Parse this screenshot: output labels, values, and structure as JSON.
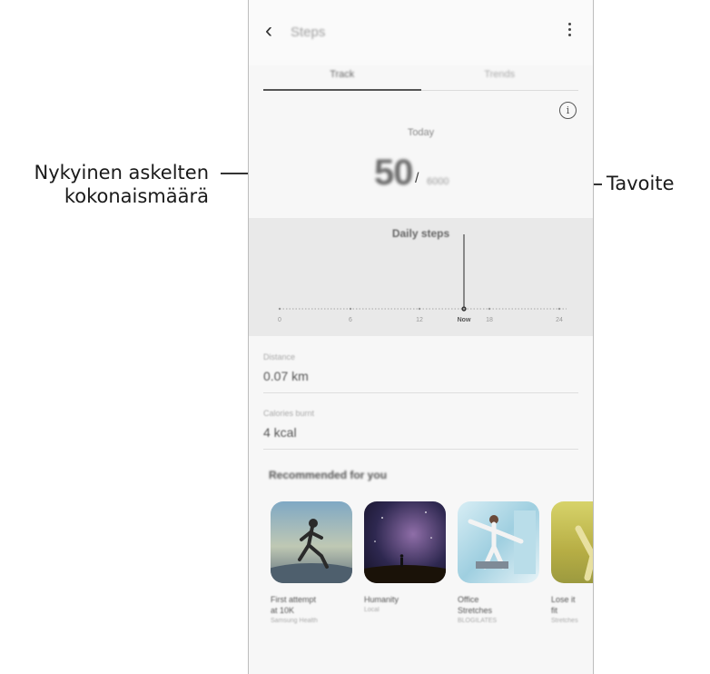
{
  "callouts": {
    "current_total_line1": "Nykyinen askelten",
    "current_total_line2": "kokonaismäärä",
    "target": "Tavoite"
  },
  "app": {
    "title": "Steps",
    "tabs": [
      {
        "label": "Track"
      },
      {
        "label": "Trends"
      }
    ]
  },
  "summary": {
    "day": "Today",
    "count": "50",
    "separator": "/",
    "goal": "6000",
    "label": "Daily steps"
  },
  "timeline": {
    "ticks": [
      "0",
      "6",
      "12",
      "Now",
      "18",
      "24"
    ],
    "current_hour_label": "Now"
  },
  "stats": [
    {
      "label": "Distance",
      "value": "0.07 km"
    },
    {
      "label": "Calories burnt",
      "value": "4 kcal"
    }
  ],
  "recommended": {
    "heading": "Recommended for you",
    "cards": [
      {
        "title_line1": "First attempt",
        "title_line2": "at 10K",
        "source": "Samsung Health"
      },
      {
        "title_line1": "Humanity",
        "title_line2": "",
        "source": "Local"
      },
      {
        "title_line1": "Office",
        "title_line2": "Stretches",
        "source": "BLOGILATES"
      },
      {
        "title_line1": "Lose it",
        "title_line2": "fit",
        "source": "Stretches"
      }
    ]
  },
  "colors": {
    "leader_line": "#333333",
    "chart_bg": "#e9e9e9",
    "indicator": "#555555"
  },
  "icons": {
    "back": "chevron-left-icon",
    "more": "more-vert-icon",
    "info": "info-icon"
  }
}
